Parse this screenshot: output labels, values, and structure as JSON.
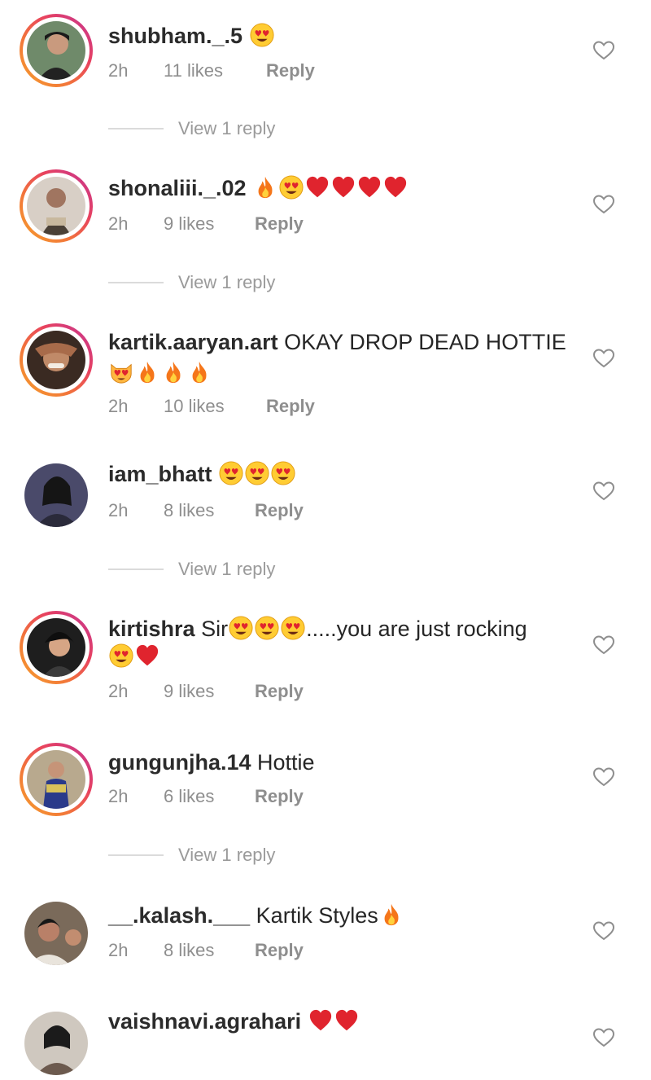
{
  "comments": [
    {
      "username": "shubham._.5",
      "text": "",
      "emojis": [
        "heart-eyes-icon"
      ],
      "time": "2h",
      "likes": "11 likes",
      "reply": "Reply",
      "view_replies": "View 1 reply"
    },
    {
      "username": "shonaliii._.02",
      "text": "",
      "emojis": [
        "fire-icon",
        "heart-eyes-icon",
        "red-heart-icon",
        "red-heart-icon",
        "red-heart-icon",
        "red-heart-icon"
      ],
      "time": "2h",
      "likes": "9 likes",
      "reply": "Reply",
      "view_replies": "View 1 reply"
    },
    {
      "username": "kartik.aaryan.art",
      "text": "OKAY DROP DEAD HOTTIE",
      "emojis": [
        "heart-eyes-cat-icon",
        "fire-icon",
        "fire-icon",
        "fire-icon"
      ],
      "time": "2h",
      "likes": "10 likes",
      "reply": "Reply",
      "view_replies": ""
    },
    {
      "username": "iam_bhatt",
      "text": "",
      "emojis": [
        "heart-eyes-icon",
        "heart-eyes-icon",
        "heart-eyes-icon"
      ],
      "time": "2h",
      "likes": "8 likes",
      "reply": "Reply",
      "view_replies": "View 1 reply"
    },
    {
      "username": "kirtishra",
      "text": "Sir",
      "text_after": ".....you are just rocking",
      "emojis": [
        "heart-eyes-icon",
        "heart-eyes-icon",
        "heart-eyes-icon"
      ],
      "emojis_line2": [
        "heart-eyes-icon",
        "red-heart-icon"
      ],
      "time": "2h",
      "likes": "9 likes",
      "reply": "Reply",
      "view_replies": ""
    },
    {
      "username": "gungunjha.14",
      "text": "Hottie",
      "emojis": [],
      "time": "2h",
      "likes": "6 likes",
      "reply": "Reply",
      "view_replies": "View 1 reply"
    },
    {
      "username": "__.kalash.___",
      "text": "Kartik Styles",
      "emojis": [
        "fire-icon"
      ],
      "time": "2h",
      "likes": "8 likes",
      "reply": "Reply",
      "view_replies": ""
    },
    {
      "username": "vaishnavi.agrahari",
      "text": "",
      "emojis": [
        "red-heart-icon",
        "red-heart-icon"
      ],
      "time": "",
      "likes": "",
      "reply": "",
      "view_replies": ""
    }
  ],
  "colors": {
    "story_ring_start": "#f6a12c",
    "story_ring_end": "#c23496",
    "meta_text": "#8e8e8e",
    "heart_red": "#e0242e"
  }
}
